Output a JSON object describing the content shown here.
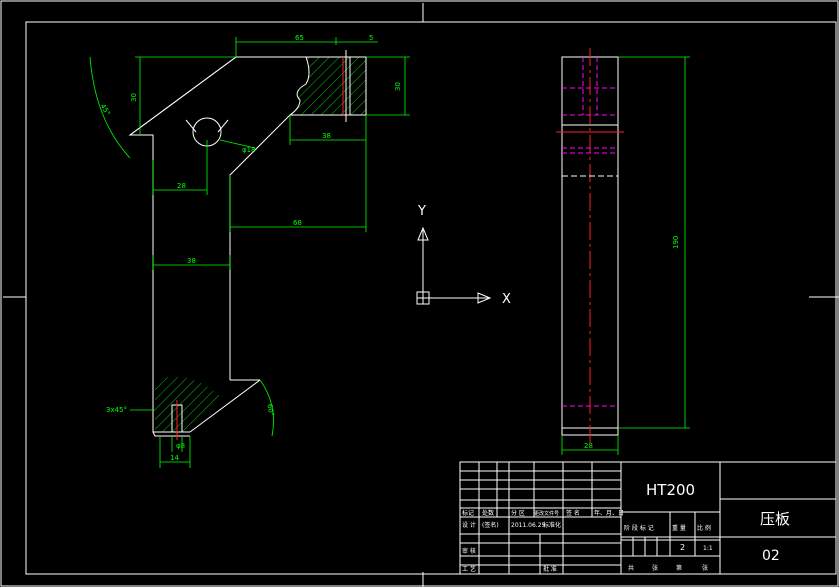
{
  "drawing": {
    "front_dims": {
      "d65": "65",
      "d5": "5",
      "d30a": "30",
      "d30b": "30",
      "d38a": "38",
      "d28": "28",
      "d68": "68",
      "d38b": "38",
      "d18": "φ18",
      "a45": "45°",
      "chamfer": "3x45°",
      "d14": "14",
      "d8": "φ8",
      "a60": "60°"
    },
    "side_dims": {
      "h190": "190",
      "w28": "28"
    },
    "ucs": {
      "y_label": "Y",
      "x_label": "X"
    }
  },
  "title_block": {
    "material": "HT200",
    "part_name": "压板",
    "drawing_no": "02",
    "header_row": [
      "标记",
      "处数",
      "分 区",
      "更改文件号",
      "签 名",
      "年、月、日"
    ],
    "design_row": [
      "设 计",
      "(签名)",
      "2011.06.25",
      "标准化"
    ],
    "stage_labels": [
      "阶 段 标 记",
      "重 量",
      "比 例"
    ],
    "quantity": "2",
    "scale": "1:1",
    "review_label": "审 核",
    "process_label": "工 艺",
    "approve_label": "批 准",
    "sheet_text": [
      "共",
      "张",
      "第",
      "张"
    ]
  }
}
